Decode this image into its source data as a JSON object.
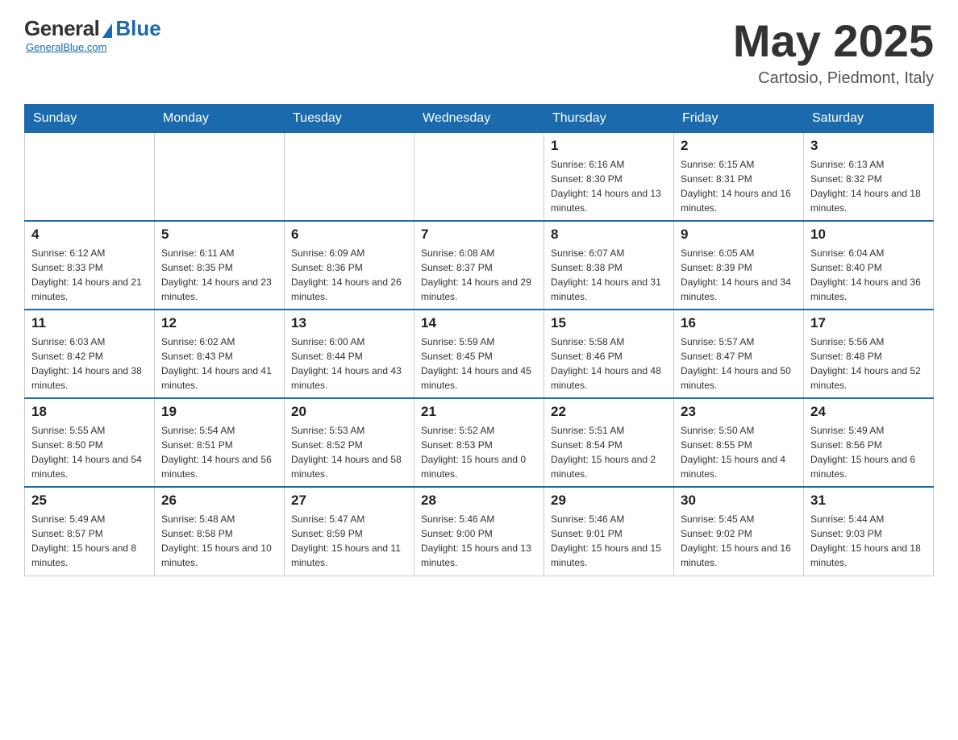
{
  "header": {
    "logo": {
      "general": "General",
      "blue": "Blue",
      "underline": "GeneralBlue.com"
    },
    "title": "May 2025",
    "location": "Cartosio, Piedmont, Italy"
  },
  "days_of_week": [
    "Sunday",
    "Monday",
    "Tuesday",
    "Wednesday",
    "Thursday",
    "Friday",
    "Saturday"
  ],
  "weeks": [
    {
      "days": [
        {
          "number": "",
          "info": ""
        },
        {
          "number": "",
          "info": ""
        },
        {
          "number": "",
          "info": ""
        },
        {
          "number": "",
          "info": ""
        },
        {
          "number": "1",
          "info": "Sunrise: 6:16 AM\nSunset: 8:30 PM\nDaylight: 14 hours and 13 minutes."
        },
        {
          "number": "2",
          "info": "Sunrise: 6:15 AM\nSunset: 8:31 PM\nDaylight: 14 hours and 16 minutes."
        },
        {
          "number": "3",
          "info": "Sunrise: 6:13 AM\nSunset: 8:32 PM\nDaylight: 14 hours and 18 minutes."
        }
      ]
    },
    {
      "days": [
        {
          "number": "4",
          "info": "Sunrise: 6:12 AM\nSunset: 8:33 PM\nDaylight: 14 hours and 21 minutes."
        },
        {
          "number": "5",
          "info": "Sunrise: 6:11 AM\nSunset: 8:35 PM\nDaylight: 14 hours and 23 minutes."
        },
        {
          "number": "6",
          "info": "Sunrise: 6:09 AM\nSunset: 8:36 PM\nDaylight: 14 hours and 26 minutes."
        },
        {
          "number": "7",
          "info": "Sunrise: 6:08 AM\nSunset: 8:37 PM\nDaylight: 14 hours and 29 minutes."
        },
        {
          "number": "8",
          "info": "Sunrise: 6:07 AM\nSunset: 8:38 PM\nDaylight: 14 hours and 31 minutes."
        },
        {
          "number": "9",
          "info": "Sunrise: 6:05 AM\nSunset: 8:39 PM\nDaylight: 14 hours and 34 minutes."
        },
        {
          "number": "10",
          "info": "Sunrise: 6:04 AM\nSunset: 8:40 PM\nDaylight: 14 hours and 36 minutes."
        }
      ]
    },
    {
      "days": [
        {
          "number": "11",
          "info": "Sunrise: 6:03 AM\nSunset: 8:42 PM\nDaylight: 14 hours and 38 minutes."
        },
        {
          "number": "12",
          "info": "Sunrise: 6:02 AM\nSunset: 8:43 PM\nDaylight: 14 hours and 41 minutes."
        },
        {
          "number": "13",
          "info": "Sunrise: 6:00 AM\nSunset: 8:44 PM\nDaylight: 14 hours and 43 minutes."
        },
        {
          "number": "14",
          "info": "Sunrise: 5:59 AM\nSunset: 8:45 PM\nDaylight: 14 hours and 45 minutes."
        },
        {
          "number": "15",
          "info": "Sunrise: 5:58 AM\nSunset: 8:46 PM\nDaylight: 14 hours and 48 minutes."
        },
        {
          "number": "16",
          "info": "Sunrise: 5:57 AM\nSunset: 8:47 PM\nDaylight: 14 hours and 50 minutes."
        },
        {
          "number": "17",
          "info": "Sunrise: 5:56 AM\nSunset: 8:48 PM\nDaylight: 14 hours and 52 minutes."
        }
      ]
    },
    {
      "days": [
        {
          "number": "18",
          "info": "Sunrise: 5:55 AM\nSunset: 8:50 PM\nDaylight: 14 hours and 54 minutes."
        },
        {
          "number": "19",
          "info": "Sunrise: 5:54 AM\nSunset: 8:51 PM\nDaylight: 14 hours and 56 minutes."
        },
        {
          "number": "20",
          "info": "Sunrise: 5:53 AM\nSunset: 8:52 PM\nDaylight: 14 hours and 58 minutes."
        },
        {
          "number": "21",
          "info": "Sunrise: 5:52 AM\nSunset: 8:53 PM\nDaylight: 15 hours and 0 minutes."
        },
        {
          "number": "22",
          "info": "Sunrise: 5:51 AM\nSunset: 8:54 PM\nDaylight: 15 hours and 2 minutes."
        },
        {
          "number": "23",
          "info": "Sunrise: 5:50 AM\nSunset: 8:55 PM\nDaylight: 15 hours and 4 minutes."
        },
        {
          "number": "24",
          "info": "Sunrise: 5:49 AM\nSunset: 8:56 PM\nDaylight: 15 hours and 6 minutes."
        }
      ]
    },
    {
      "days": [
        {
          "number": "25",
          "info": "Sunrise: 5:49 AM\nSunset: 8:57 PM\nDaylight: 15 hours and 8 minutes."
        },
        {
          "number": "26",
          "info": "Sunrise: 5:48 AM\nSunset: 8:58 PM\nDaylight: 15 hours and 10 minutes."
        },
        {
          "number": "27",
          "info": "Sunrise: 5:47 AM\nSunset: 8:59 PM\nDaylight: 15 hours and 11 minutes."
        },
        {
          "number": "28",
          "info": "Sunrise: 5:46 AM\nSunset: 9:00 PM\nDaylight: 15 hours and 13 minutes."
        },
        {
          "number": "29",
          "info": "Sunrise: 5:46 AM\nSunset: 9:01 PM\nDaylight: 15 hours and 15 minutes."
        },
        {
          "number": "30",
          "info": "Sunrise: 5:45 AM\nSunset: 9:02 PM\nDaylight: 15 hours and 16 minutes."
        },
        {
          "number": "31",
          "info": "Sunrise: 5:44 AM\nSunset: 9:03 PM\nDaylight: 15 hours and 18 minutes."
        }
      ]
    }
  ]
}
